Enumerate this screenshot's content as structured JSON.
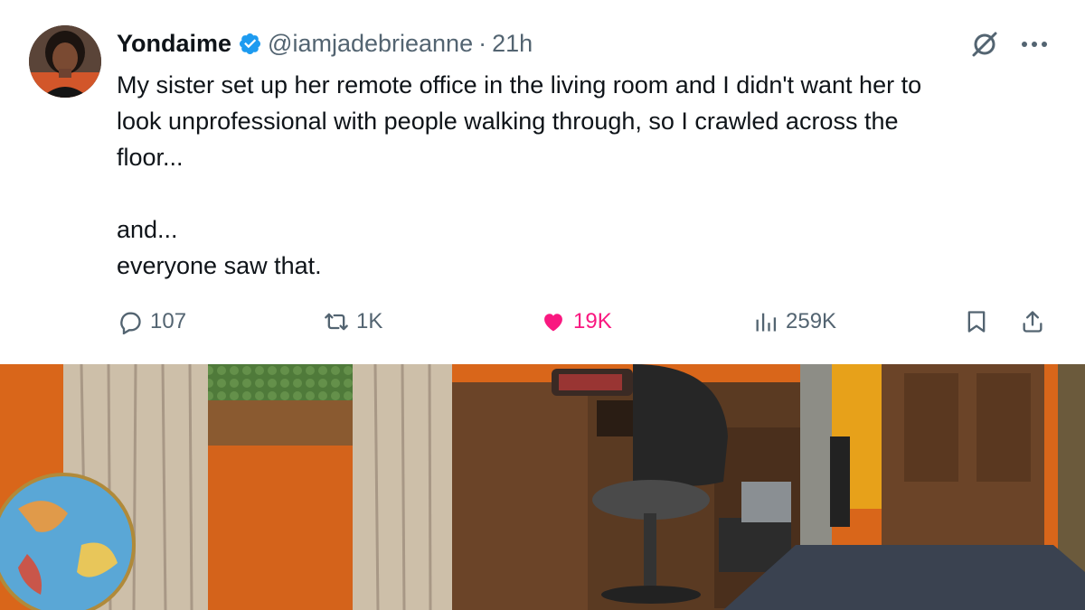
{
  "tweet": {
    "author": {
      "display_name": "Yondaime",
      "handle": "@iamjadebrieanne",
      "separator": "·",
      "time": "21h",
      "verified": true,
      "verified_color": "#1d9bf0"
    },
    "text_lines": [
      "My sister set up her remote office in the living room and I didn't want her to\nlook unprofessional with people walking through, so I crawled across the\nfloor...",
      "and...\neveryone saw that."
    ],
    "metrics": {
      "replies": "107",
      "reposts": "1K",
      "likes": "19K",
      "views": "259K"
    },
    "liked": true,
    "like_color": "#f91880",
    "icons": [
      "grok-icon",
      "more-icon",
      "reply-icon",
      "repost-icon",
      "heart-icon",
      "views-icon",
      "bookmark-icon",
      "share-icon"
    ]
  },
  "photo": {
    "description_colors": {
      "wall": "#d9661a",
      "desk": "#5a3a22",
      "door": "#6b4428",
      "carpet": "#3a4250",
      "curtain": "#cdbfa9"
    }
  }
}
